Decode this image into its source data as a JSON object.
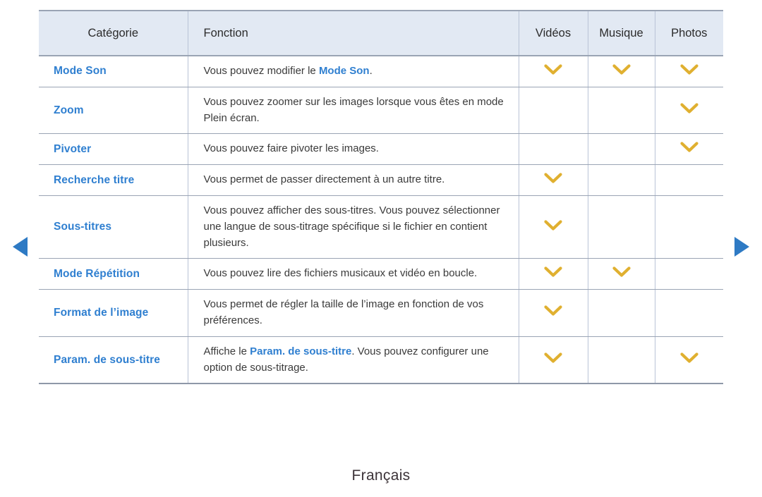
{
  "nav": {
    "prev_icon": "triangle-left-icon",
    "next_icon": "triangle-right-icon",
    "arrow_color": "#2e7ac4"
  },
  "table": {
    "headers": {
      "category": "Catégorie",
      "function": "Fonction",
      "videos": "Vidéos",
      "music": "Musique",
      "photos": "Photos"
    },
    "mark_icon": "chevron-down-icon",
    "mark_color": "#e0b030",
    "header_background": "#e2e9f3",
    "link_color": "#2f7fd0",
    "rows": [
      {
        "category": "Mode Son",
        "function_parts": [
          {
            "text": "Vous pouvez modifier le ",
            "highlight": false
          },
          {
            "text": "Mode Son",
            "highlight": true
          },
          {
            "text": ".",
            "highlight": false
          }
        ],
        "function_plain": "Vous pouvez modifier le Mode Son.",
        "videos": true,
        "music": true,
        "photos": true
      },
      {
        "category": "Zoom",
        "function_parts": [
          {
            "text": "Vous pouvez zoomer sur les images lorsque vous êtes en mode Plein écran.",
            "highlight": false
          }
        ],
        "function_plain": "Vous pouvez zoomer sur les images lorsque vous êtes en mode Plein écran.",
        "videos": false,
        "music": false,
        "photos": true
      },
      {
        "category": "Pivoter",
        "function_parts": [
          {
            "text": "Vous pouvez faire pivoter les images.",
            "highlight": false
          }
        ],
        "function_plain": "Vous pouvez faire pivoter les images.",
        "videos": false,
        "music": false,
        "photos": true
      },
      {
        "category": "Recherche titre",
        "function_parts": [
          {
            "text": "Vous permet de passer directement à un autre titre.",
            "highlight": false
          }
        ],
        "function_plain": "Vous permet de passer directement à un autre titre.",
        "videos": true,
        "music": false,
        "photos": false
      },
      {
        "category": "Sous-titres",
        "function_parts": [
          {
            "text": "Vous pouvez afficher des sous-titres. Vous pouvez sélectionner une langue de sous-titrage spécifique si le fichier en contient plusieurs.",
            "highlight": false
          }
        ],
        "function_plain": "Vous pouvez afficher des sous-titres. Vous pouvez sélectionner une langue de sous-titrage spécifique si le fichier en contient plusieurs.",
        "videos": true,
        "music": false,
        "photos": false
      },
      {
        "category": "Mode Répétition",
        "function_parts": [
          {
            "text": "Vous pouvez lire des fichiers musicaux et vidéo en boucle.",
            "highlight": false
          }
        ],
        "function_plain": "Vous pouvez lire des fichiers musicaux et vidéo en boucle.",
        "videos": true,
        "music": true,
        "photos": false
      },
      {
        "category": "Format de l’image",
        "function_parts": [
          {
            "text": "Vous permet de régler la taille de l’image en fonction de vos préférences.",
            "highlight": false
          }
        ],
        "function_plain": "Vous permet de régler la taille de l’image en fonction de vos préférences.",
        "videos": true,
        "music": false,
        "photos": false
      },
      {
        "category": "Param. de sous-titre",
        "function_parts": [
          {
            "text": "Affiche le ",
            "highlight": false
          },
          {
            "text": "Param. de sous-titre",
            "highlight": true
          },
          {
            "text": ". Vous pouvez configurer une option de sous-titrage.",
            "highlight": false
          }
        ],
        "function_plain": "Affiche le Param. de sous-titre. Vous pouvez configurer une option de sous-titrage.",
        "videos": true,
        "music": false,
        "photos": true
      }
    ]
  },
  "footer": {
    "language": "Français"
  }
}
